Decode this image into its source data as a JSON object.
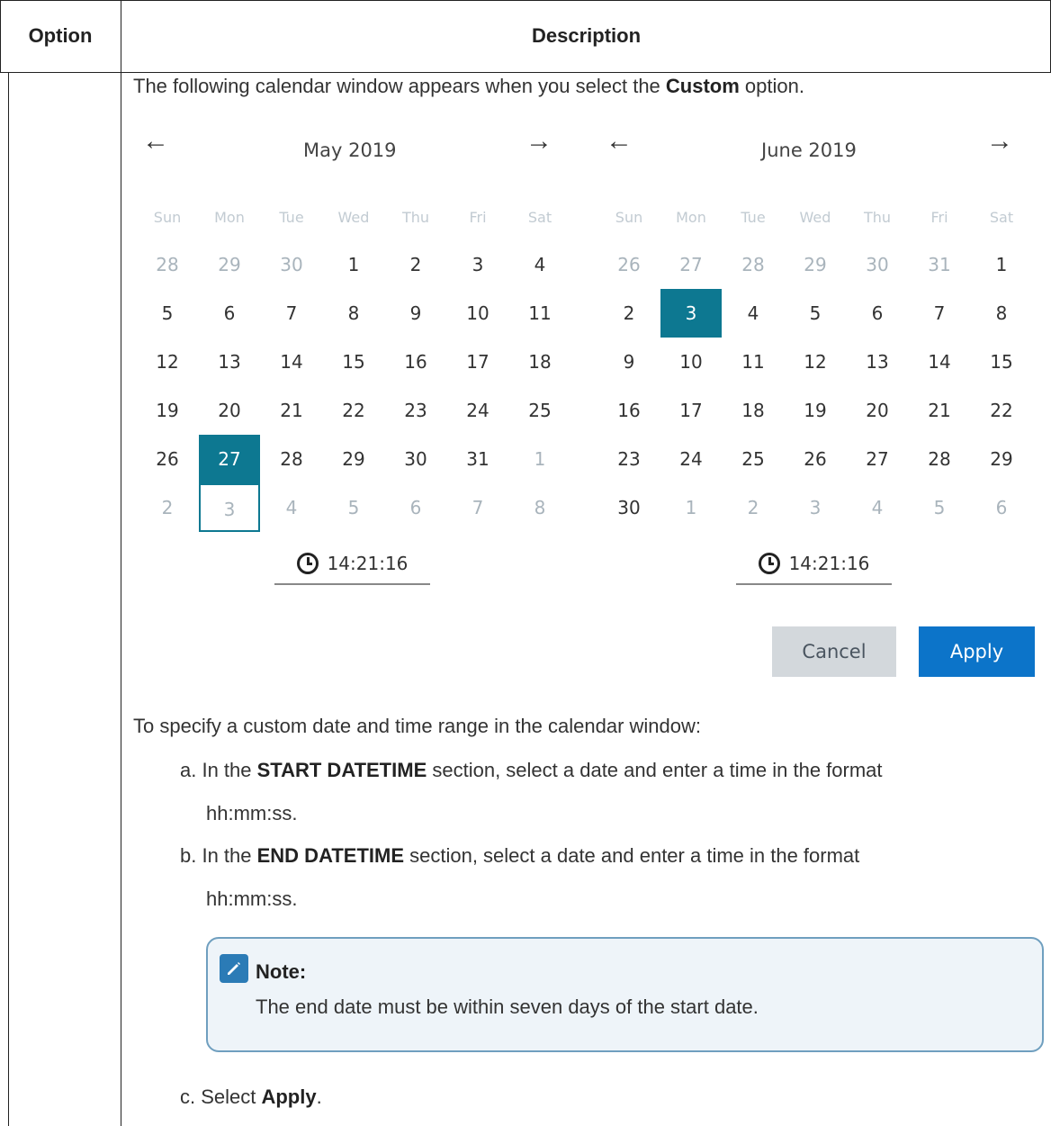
{
  "table": {
    "headers": [
      "Option",
      "Description"
    ]
  },
  "intro": {
    "pre": "The following calendar window appears when you select the ",
    "bold": "Custom",
    "post": " option."
  },
  "calendar": {
    "left": {
      "month": "May 2019",
      "dow": [
        "Sun",
        "Mon",
        "Tue",
        "Wed",
        "Thu",
        "Fri",
        "Sat"
      ],
      "weeks": [
        [
          "28",
          "29",
          "30",
          "1",
          "2",
          "3",
          "4"
        ],
        [
          "5",
          "6",
          "7",
          "8",
          "9",
          "10",
          "11"
        ],
        [
          "12",
          "13",
          "14",
          "15",
          "16",
          "17",
          "18"
        ],
        [
          "19",
          "20",
          "21",
          "22",
          "23",
          "24",
          "25"
        ],
        [
          "26",
          "27",
          "28",
          "29",
          "30",
          "31",
          "1"
        ],
        [
          "2",
          "3",
          "4",
          "5",
          "6",
          "7",
          "8"
        ]
      ],
      "selected_day": "27",
      "time": "14:21:16"
    },
    "right": {
      "month": "June 2019",
      "dow": [
        "Sun",
        "Mon",
        "Tue",
        "Wed",
        "Thu",
        "Fri",
        "Sat"
      ],
      "weeks": [
        [
          "26",
          "27",
          "28",
          "29",
          "30",
          "31",
          "1"
        ],
        [
          "2",
          "3",
          "4",
          "5",
          "6",
          "7",
          "8"
        ],
        [
          "9",
          "10",
          "11",
          "12",
          "13",
          "14",
          "15"
        ],
        [
          "16",
          "17",
          "18",
          "19",
          "20",
          "21",
          "22"
        ],
        [
          "23",
          "24",
          "25",
          "26",
          "27",
          "28",
          "29"
        ],
        [
          "30",
          "1",
          "2",
          "3",
          "4",
          "5",
          "6"
        ]
      ],
      "selected_day": "3",
      "time": "14:21:16"
    },
    "prev_arrow": "←",
    "next_arrow": "→",
    "cancel_label": "Cancel",
    "apply_label": "Apply"
  },
  "steps": {
    "lead": "To specify a custom date and time range in the calendar window:",
    "a_pre": "a. In the ",
    "a_bold": "START DATETIME",
    "a_post": " section, select a date and enter a time in the format",
    "a_cont": "hh:mm:ss.",
    "b_pre": "b. In the ",
    "b_bold": "END DATETIME",
    "b_post": " section, select a date and enter a time in the format",
    "b_cont": "hh:mm:ss.",
    "c_pre": "c. Select ",
    "c_bold": "Apply",
    "c_post": "."
  },
  "note": {
    "title": "Note:",
    "text": "The end date must be within seven days of the start date.",
    "icon": "pencil-icon"
  },
  "colors": {
    "selected": "#0d7891",
    "apply": "#0c74c9",
    "cancel": "#d3d8dc",
    "note_border": "#6f9fbf",
    "note_bg": "#eef4f9"
  }
}
